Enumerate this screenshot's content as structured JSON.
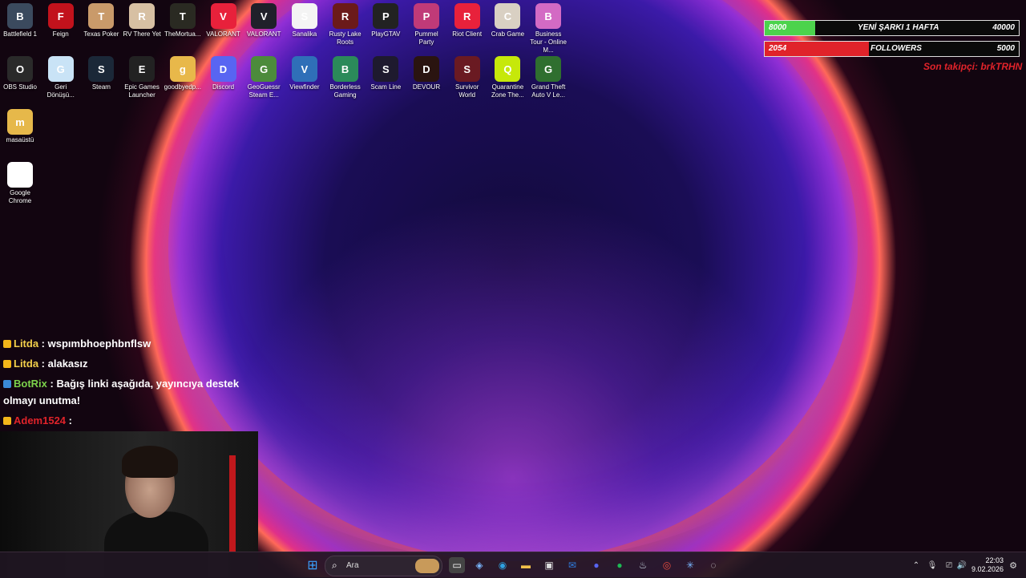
{
  "desktop_row1": [
    {
      "label": "Battlefield 1",
      "bg": "#3b4a5e"
    },
    {
      "label": "Feign",
      "bg": "#c2121c"
    },
    {
      "label": "Texas Poker",
      "bg": "#c99a6a"
    },
    {
      "label": "RV There Yet",
      "bg": "#d7c0a3"
    },
    {
      "label": "TheMortua...",
      "bg": "#2a2a22"
    },
    {
      "label": "VALORANT",
      "bg": "#e8213b"
    },
    {
      "label": "VALORANT",
      "bg": "#20202a"
    },
    {
      "label": "Sanalika",
      "bg": "#f4f4f4"
    },
    {
      "label": "Rusty Lake Roots",
      "bg": "#6b1a1a"
    },
    {
      "label": "PlayGTAV",
      "bg": "#222222"
    },
    {
      "label": "Pummel Party",
      "bg": "#c03a78"
    },
    {
      "label": "Riot Client",
      "bg": "#e8213b"
    },
    {
      "label": "Crab Game",
      "bg": "#d9d0c3"
    },
    {
      "label": "Business Tour - Online M...",
      "bg": "#d36ac4"
    }
  ],
  "desktop_row2": [
    {
      "label": "OBS Studio",
      "bg": "#2a2a2a"
    },
    {
      "label": "Geri Dönüşü...",
      "bg": "#c9e3f6"
    },
    {
      "label": "Steam",
      "bg": "#1b2838"
    },
    {
      "label": "Epic Games Launcher",
      "bg": "#222222"
    },
    {
      "label": "goodbyedp...",
      "bg": "#e8b84a"
    },
    {
      "label": "Discord",
      "bg": "#5865f2"
    },
    {
      "label": "GeoGuessr Steam E...",
      "bg": "#4c8b3c"
    },
    {
      "label": "Viewfinder",
      "bg": "#2f6fb8"
    },
    {
      "label": "Borderless Gaming",
      "bg": "#2b8a5a"
    },
    {
      "label": "Scam Line",
      "bg": "#1e1a2e"
    },
    {
      "label": "DEVOUR",
      "bg": "#2a1410"
    },
    {
      "label": "Survivor World",
      "bg": "#6a1a22"
    },
    {
      "label": "Quarantine Zone The...",
      "bg": "#c6e80a"
    },
    {
      "label": "Grand Theft Auto V Le...",
      "bg": "#2f6f2f"
    }
  ],
  "desktop_col": [
    {
      "label": "masaüstü",
      "bg": "#e6b84a"
    },
    {
      "label": "Google Chrome",
      "bg": "#ffffff"
    }
  ],
  "overlay": {
    "goal1": {
      "current": "8000",
      "title": "YENİ ŞARKI 1 HAFTA",
      "target": "40000",
      "fill_pct": 20,
      "color": "#4cd34c"
    },
    "goal2": {
      "current": "2054",
      "title": "FOLLOWERS",
      "target": "5000",
      "fill_pct": 41,
      "color": "#e0232a"
    },
    "last_follower": "Son takipçi: brkTRHN"
  },
  "chat": [
    {
      "user": "Litda",
      "text": "wspımbhoephbnflsw",
      "color": "#f2d04b"
    },
    {
      "user": "Litda",
      "text": "alakasız",
      "color": "#f2d04b"
    },
    {
      "user": "BotRix",
      "text": "Bağış linki aşağıda, yayıncıya destek olmayı unutma!",
      "color": "#7cd34b"
    },
    {
      "user": "Adem1524",
      "text": "",
      "color": "#e0232a"
    }
  ],
  "taskbar": {
    "search_placeholder": "Ara",
    "time": "22:03",
    "date": "9.02.2026"
  }
}
